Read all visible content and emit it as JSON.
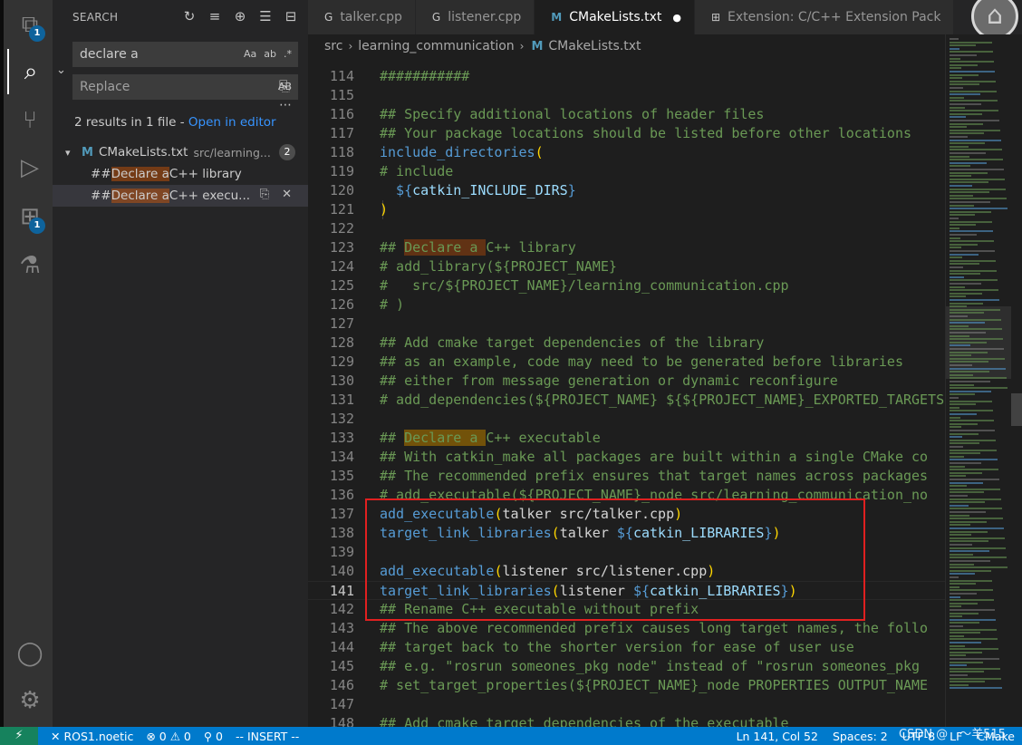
{
  "activity_bar": {
    "items": [
      {
        "name": "explorer-icon",
        "glyph": "⧉",
        "badge": "1"
      },
      {
        "name": "search-icon",
        "glyph": "⌕",
        "badge": ""
      },
      {
        "name": "source-control-icon",
        "glyph": "⑂",
        "badge": ""
      },
      {
        "name": "run-debug-icon",
        "glyph": "▷",
        "badge": ""
      },
      {
        "name": "extensions-icon",
        "glyph": "⊞",
        "badge": "1"
      },
      {
        "name": "testing-icon",
        "glyph": "⚗",
        "badge": ""
      }
    ],
    "account_icon": "◯",
    "settings_icon": "⚙"
  },
  "sidebar": {
    "title": "SEARCH",
    "search_value": "declare a",
    "search_opts": [
      "Aa",
      "ab",
      ".*"
    ],
    "replace_placeholder": "Replace",
    "replace_opt": "AB",
    "results_text": "2 results in 1 file - ",
    "open_editor_link": "Open in editor",
    "file": {
      "name": "CMakeLists.txt",
      "path": "src/learning...",
      "count": "2",
      "icon": "M"
    },
    "matches": [
      {
        "prefix": "## ",
        "match": "Declare a",
        "suffix": " C++ library"
      },
      {
        "prefix": "## ",
        "match": "Declare a",
        "suffix": " C++ execu..."
      }
    ]
  },
  "tabs": [
    {
      "label": "talker.cpp",
      "icon": "G"
    },
    {
      "label": "listener.cpp",
      "icon": "G"
    },
    {
      "label": "CMakeLists.txt",
      "icon": "M",
      "dirty": "●"
    },
    {
      "label": "Extension: C/C++ Extension Pack",
      "icon": "⊞"
    }
  ],
  "breadcrumb": {
    "folder": "src",
    "sub": "learning_communication",
    "file": "CMakeLists.txt"
  },
  "editor_lines": [
    {
      "n": "114",
      "segs": [
        [
          "###########",
          "com"
        ]
      ]
    },
    {
      "n": "115",
      "segs": []
    },
    {
      "n": "116",
      "segs": [
        [
          "## Specify additional locations of header files",
          "com"
        ]
      ]
    },
    {
      "n": "117",
      "segs": [
        [
          "## Your package locations should be listed before other locations",
          "com"
        ]
      ]
    },
    {
      "n": "118",
      "segs": [
        [
          "include_directories",
          "fn"
        ],
        [
          "(",
          "brk"
        ]
      ]
    },
    {
      "n": "119",
      "segs": [
        [
          "# include",
          "com"
        ]
      ]
    },
    {
      "n": "120",
      "segs": [
        [
          "  ${",
          "fn"
        ],
        [
          "catkin_INCLUDE_DIRS",
          "var"
        ],
        [
          "}",
          "fn"
        ]
      ]
    },
    {
      "n": "121",
      "segs": [
        [
          ")",
          "brk"
        ]
      ]
    },
    {
      "n": "122",
      "segs": []
    },
    {
      "n": "123",
      "segs": [
        [
          "## ",
          "com"
        ],
        [
          "Declare a ",
          "find"
        ],
        [
          "C++ library",
          "com"
        ]
      ]
    },
    {
      "n": "124",
      "segs": [
        [
          "# add_library(${PROJECT_NAME}",
          "com"
        ]
      ]
    },
    {
      "n": "125",
      "segs": [
        [
          "#   src/${PROJECT_NAME}/learning_communication.cpp",
          "com"
        ]
      ]
    },
    {
      "n": "126",
      "segs": [
        [
          "# )",
          "com"
        ]
      ]
    },
    {
      "n": "127",
      "segs": []
    },
    {
      "n": "128",
      "segs": [
        [
          "## Add cmake target dependencies of the library",
          "com"
        ]
      ]
    },
    {
      "n": "129",
      "segs": [
        [
          "## as an example, code may need to be generated before libraries",
          "com"
        ]
      ]
    },
    {
      "n": "130",
      "segs": [
        [
          "## either from message generation or dynamic reconfigure",
          "com"
        ]
      ]
    },
    {
      "n": "131",
      "segs": [
        [
          "# add_dependencies(${PROJECT_NAME} ${${PROJECT_NAME}_EXPORTED_TARGETS}",
          "com"
        ]
      ]
    },
    {
      "n": "132",
      "segs": []
    },
    {
      "n": "133",
      "segs": [
        [
          "## ",
          "com"
        ],
        [
          "Declare a ",
          "findcur"
        ],
        [
          "C++ executable",
          "com"
        ]
      ]
    },
    {
      "n": "134",
      "segs": [
        [
          "## With catkin_make all packages are built within a single CMake co",
          "com"
        ]
      ]
    },
    {
      "n": "135",
      "segs": [
        [
          "## The recommended prefix ensures that target names across packages",
          "com"
        ]
      ]
    },
    {
      "n": "136",
      "segs": [
        [
          "# add_executable(${PROJECT_NAME}_node src/learning_communication_no",
          "com"
        ]
      ]
    },
    {
      "n": "137",
      "segs": [
        [
          "add_executable",
          "fn"
        ],
        [
          "(",
          "brk"
        ],
        [
          "talker src/talker.cpp",
          "txt"
        ],
        [
          ")",
          "brk"
        ]
      ]
    },
    {
      "n": "138",
      "segs": [
        [
          "target_link_libraries",
          "fn"
        ],
        [
          "(",
          "brk"
        ],
        [
          "talker ",
          "txt"
        ],
        [
          "${",
          "fn"
        ],
        [
          "catkin_LIBRARIES",
          "var"
        ],
        [
          "}",
          "fn"
        ],
        [
          ")",
          "brk"
        ]
      ]
    },
    {
      "n": "139",
      "segs": []
    },
    {
      "n": "140",
      "segs": [
        [
          "add_executable",
          "fn"
        ],
        [
          "(",
          "brk"
        ],
        [
          "listener src/listener.cpp",
          "txt"
        ],
        [
          ")",
          "brk"
        ]
      ]
    },
    {
      "n": "141",
      "segs": [
        [
          "target_link_libraries",
          "fn"
        ],
        [
          "(",
          "brk"
        ],
        [
          "listener ",
          "txt"
        ],
        [
          "${",
          "fn"
        ],
        [
          "catkin_LIBRARIES",
          "var"
        ],
        [
          "}",
          "fn"
        ],
        [
          ")",
          "brk"
        ]
      ],
      "current": true
    },
    {
      "n": "142",
      "segs": [
        [
          "## Rename C++ executable without prefix",
          "com"
        ]
      ]
    },
    {
      "n": "143",
      "segs": [
        [
          "## The above recommended prefix causes long target names, the follo",
          "com"
        ]
      ]
    },
    {
      "n": "144",
      "segs": [
        [
          "## target back to the shorter version for ease of user use",
          "com"
        ]
      ]
    },
    {
      "n": "145",
      "segs": [
        [
          "## e.g. \"rosrun someones_pkg node\" instead of \"rosrun someones_pkg",
          "com"
        ]
      ]
    },
    {
      "n": "146",
      "segs": [
        [
          "# set_target_properties(${PROJECT_NAME}_node PROPERTIES OUTPUT_NAME",
          "com"
        ]
      ]
    },
    {
      "n": "147",
      "segs": []
    },
    {
      "n": "148",
      "segs": [
        [
          "## Add cmake target dependencies of the executable",
          "com"
        ]
      ]
    }
  ],
  "statusbar": {
    "remote": "⚡",
    "env": "✕ ROS1.noetic",
    "problems": "⊗ 0 ⚠ 0",
    "ports": "⚲ 0",
    "mode": "-- INSERT --",
    "position": "Ln 141, Col 52",
    "spaces": "Spaces: 2",
    "encoding": "UTF-8",
    "eol": "LF",
    "language": "CMake",
    "watermark": "CSDN @　〜羊515"
  },
  "colors": {
    "accent": "#007acc",
    "remote": "#16825d",
    "highlight_box": "#e02020"
  }
}
